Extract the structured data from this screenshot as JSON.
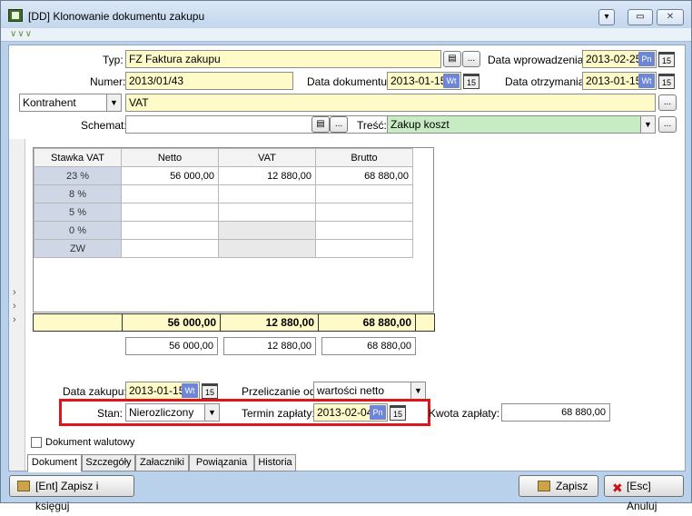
{
  "window": {
    "title": "[DD] Klonowanie dokumentu zakupu",
    "chevrons": "∨∨∨"
  },
  "header": {
    "typ_label": "Typ:",
    "typ_value": "FZ Faktura zakupu",
    "numer_label": "Numer:",
    "numer_value": "2013/01/43",
    "kontrahent_select": "Kontrahent",
    "kontrahent_value": "VAT",
    "schemat_label": "Schemat:",
    "schemat_value": "",
    "data_wprowadzenia_label": "Data wprowadzenia:",
    "data_wprowadzenia_value": "2013-02-25",
    "data_wprowadzenia_day": "Pn",
    "data_dokumentu_label": "Data dokumentu:",
    "data_dokumentu_value": "2013-01-15",
    "data_dokumentu_day": "Wt",
    "data_otrzymania_label": "Data otrzymania:",
    "data_otrzymania_value": "2013-01-15",
    "data_otrzymania_day": "Wt",
    "tresc_label": "Treść:",
    "tresc_value": "Zakup koszt",
    "ellipsis": "...",
    "cal_label": "15"
  },
  "vat_table": {
    "headers": [
      "Stawka VAT",
      "Netto",
      "VAT",
      "Brutto"
    ],
    "rows": [
      {
        "rate": "23 %",
        "netto": "56 000,00",
        "vat": "12 880,00",
        "brutto": "68 880,00"
      },
      {
        "rate": "8 %",
        "netto": "",
        "vat": "",
        "brutto": ""
      },
      {
        "rate": "5 %",
        "netto": "",
        "vat": "",
        "brutto": ""
      },
      {
        "rate": "0 %",
        "netto": "",
        "vat": "",
        "brutto": ""
      },
      {
        "rate": "ZW",
        "netto": "",
        "vat": "",
        "brutto": ""
      }
    ],
    "totals": {
      "netto": "56 000,00",
      "vat": "12 880,00",
      "brutto": "68 880,00"
    },
    "sums": {
      "netto": "56 000,00",
      "vat": "12 880,00",
      "brutto": "68 880,00"
    }
  },
  "payment": {
    "data_zakupu_label": "Data zakupu:",
    "data_zakupu_value": "2013-01-15",
    "data_zakupu_day": "Wt",
    "przeliczanie_label": "Przeliczanie od:",
    "przeliczanie_value": "wartości netto",
    "stan_label": "Stan:",
    "stan_value": "Nierozliczony",
    "termin_label": "Termin zapłaty:",
    "termin_value": "2013-02-04",
    "termin_day": "Pn",
    "kwota_label": "Kwota zapłaty:",
    "kwota_value": "68 880,00",
    "highlight_color": "#e0141b"
  },
  "dokument_walutowy": "Dokument walutowy",
  "tabs": [
    "Dokument",
    "Szczegóły",
    "Załaczniki",
    "Powiązania",
    "Historia"
  ],
  "footer": {
    "zapisz_ksieguj": "[Ent] Zapisz i księguj",
    "zapisz": "Zapisz",
    "anuluj": "[Esc] Anuluj"
  },
  "colors": {
    "required_field": "#fffbc9",
    "tresc_field": "#c7ecc4",
    "day_badge": "#6f86d6",
    "rate_cell": "#cfd7e6"
  }
}
